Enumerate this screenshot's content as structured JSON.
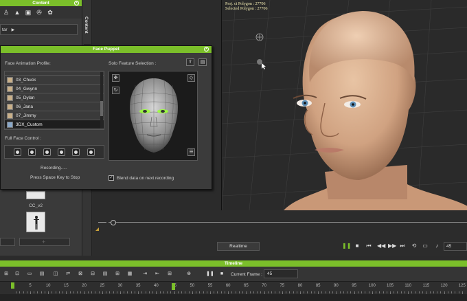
{
  "content_panel": {
    "title": "Content",
    "side_tab_label": "Content",
    "avatar_label": "tar",
    "thumb_label": "CC_v2"
  },
  "face_puppet": {
    "title": "Face Puppet",
    "profile_label": "Face Animation Profile:",
    "solo_label": "Solo Feature Selection :",
    "profiles": [
      "03_Chuck",
      "04_Gwynn",
      "05_Dylan",
      "06_Jana",
      "07_Jimmy",
      "3DX_Custom"
    ],
    "selected_profile": "3DX_Custom",
    "full_face_label": "Full Face Control :",
    "status_recording": "Recording.....",
    "status_hint": "Press Space Key to Stop",
    "blend_label": "Blend data on next recording",
    "blend_checked": true
  },
  "viewport": {
    "stats_line1": "Proj. ct Polygon : 27706",
    "stats_line2": "Selected Polygon : 27706"
  },
  "playback": {
    "realtime_label": "Realtime",
    "speed_value": "45"
  },
  "timeline": {
    "title": "Timeline",
    "current_frame_label": "Current Frame :",
    "current_frame_value": "45",
    "ticks": [
      "5",
      "10",
      "15",
      "20",
      "25",
      "30",
      "35",
      "40",
      "45",
      "50",
      "55",
      "60",
      "65",
      "70",
      "75",
      "80",
      "85",
      "90",
      "95",
      "100",
      "105",
      "110",
      "115",
      "120",
      "125"
    ]
  },
  "colors": {
    "accent": "#7bbf2a",
    "panel": "#3b3b3b",
    "background": "#2b2b2b"
  }
}
